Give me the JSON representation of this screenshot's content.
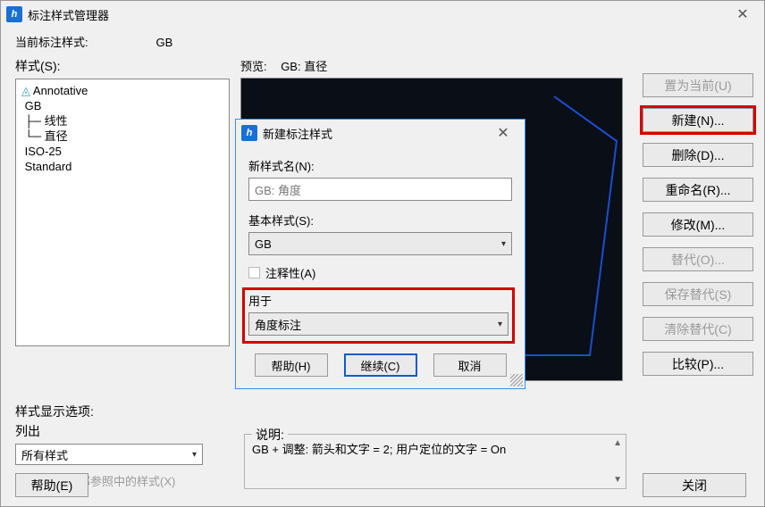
{
  "main": {
    "title": "标注样式管理器",
    "current_style_label": "当前标注样式:",
    "current_style_value": "GB",
    "styles_label": "样式(S):",
    "preview_label": "预览:",
    "preview_value": "GB: 直径",
    "tree": {
      "root1": "Annotative",
      "gb": "GB",
      "linear": "线性",
      "diameter": "直径",
      "iso25": "ISO-25",
      "standard": "Standard"
    },
    "buttons": {
      "set_current": "置为当前(U)",
      "new_": "新建(N)...",
      "delete_": "删除(D)...",
      "rename": "重命名(R)...",
      "modify": "修改(M)...",
      "override": "替代(O)...",
      "save_override": "保存替代(S)",
      "clear_override": "清除替代(C)",
      "compare": "比较(P)..."
    },
    "display_opts_label": "样式显示选项:",
    "list_label": "列出",
    "filter_value": "所有样式",
    "no_xref_label": "不列出外部参照中的样式(X)",
    "description_label": "说明:",
    "description_text": "GB + 调整: 箭头和文字 = 2; 用户定位的文字 = On",
    "help_btn": "帮助(E)",
    "close_btn": "关闭"
  },
  "dialog": {
    "title": "新建标注样式",
    "new_name_label": "新样式名(N):",
    "new_name_value": "GB: 角度",
    "base_style_label": "基本样式(S):",
    "base_style_value": "GB",
    "annotative_label": "注释性(A)",
    "use_for_label": "用于",
    "use_for_value": "角度标注",
    "help_btn": "帮助(H)",
    "continue_btn": "继续(C)",
    "cancel_btn": "取消"
  }
}
